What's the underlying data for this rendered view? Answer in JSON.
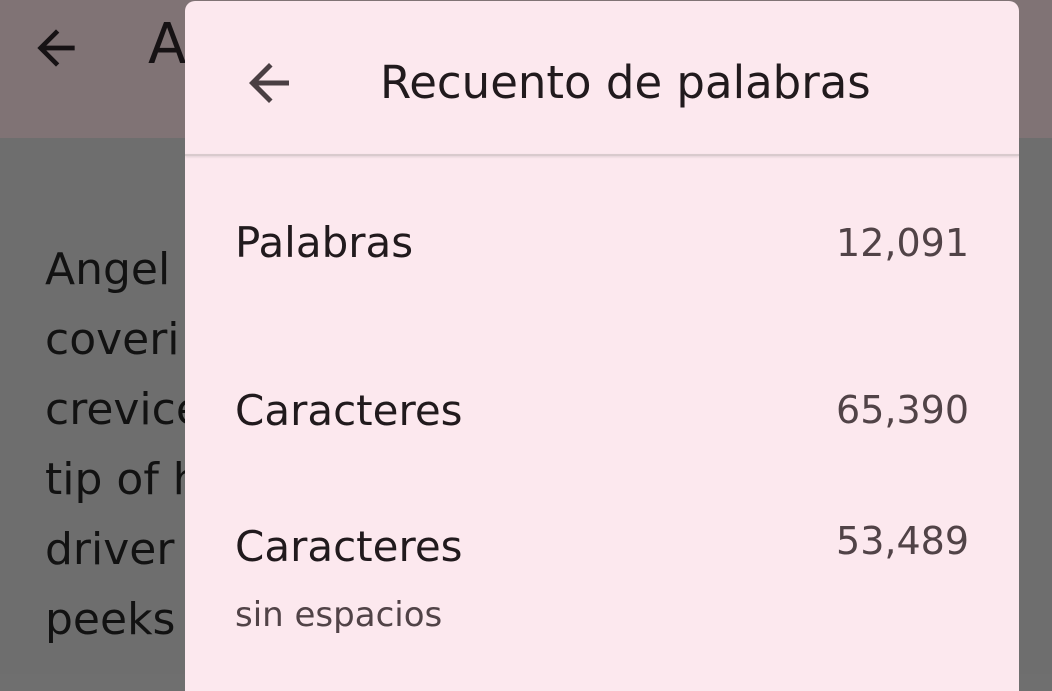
{
  "background": {
    "title": "A",
    "text_lines": [
      "Angel",
      "coveri",
      "crevice",
      "tip of h",
      "driver",
      "peeks"
    ]
  },
  "dialog": {
    "title": "Recuento de palabras",
    "rows": [
      {
        "label": "Palabras",
        "sublabel": "",
        "value": "12,091"
      },
      {
        "label": "Caracteres",
        "sublabel": "",
        "value": "65,390"
      },
      {
        "label": "Caracteres",
        "sublabel": "sin espacios",
        "value": "53,489"
      }
    ]
  },
  "colors": {
    "dialog_bg": "#fce8ee",
    "scrim": "#6e6e6e",
    "text_primary": "#211a1d",
    "text_secondary": "#514347"
  },
  "icons": {
    "back": "arrow-back-icon"
  }
}
